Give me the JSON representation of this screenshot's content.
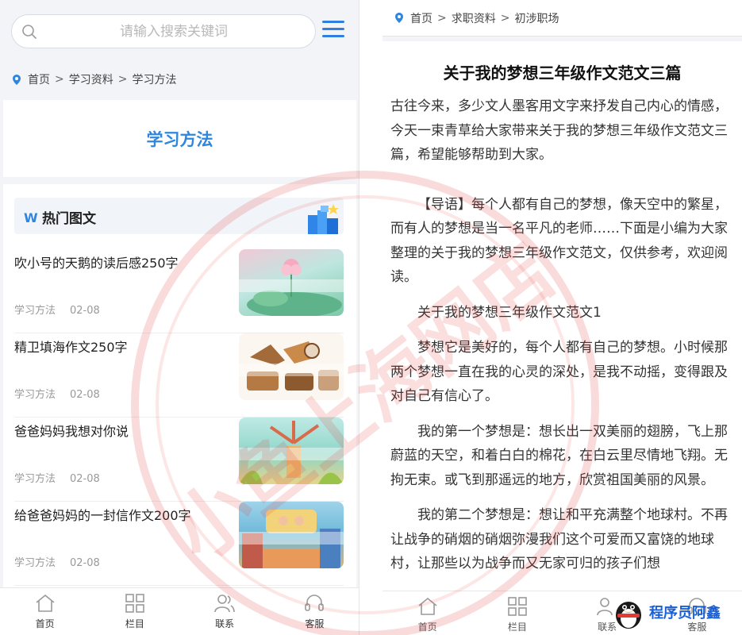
{
  "left": {
    "search": {
      "placeholder": "请输入搜索关键词"
    },
    "breadcrumb": {
      "home": "首页",
      "section": "学习资料",
      "current": "学习方法"
    },
    "page_title": "学习方法",
    "hot": {
      "title": "热门图文",
      "items": [
        {
          "title": "吹小号的天鹅的读后感250字",
          "category": "学习方法",
          "date": "02-08",
          "thumb_caption": "吹小号的天鹅的读后感250字"
        },
        {
          "title": "精卫填海作文250字",
          "category": "学习方法",
          "date": "02-08",
          "thumb_caption": ""
        },
        {
          "title": "爸爸妈妈我想对你说",
          "category": "学习方法",
          "date": "02-08",
          "thumb_caption": "爸爸妈妈我想对你说"
        },
        {
          "title": "给爸爸妈妈的一封信作文200字",
          "category": "学习方法",
          "date": "02-08",
          "thumb_caption": "给爸爸妈妈的一封信作文200字"
        }
      ]
    },
    "tabs": [
      {
        "label": "首页",
        "icon": "home-icon"
      },
      {
        "label": "栏目",
        "icon": "grid-icon"
      },
      {
        "label": "联系",
        "icon": "users-icon"
      },
      {
        "label": "客服",
        "icon": "headset-icon"
      }
    ]
  },
  "right": {
    "breadcrumb": {
      "home": "首页",
      "section": "求职资料",
      "current": "初涉职场"
    },
    "article": {
      "title": "关于我的梦想三年级作文范文三篇",
      "intro": "古往今来，多少文人墨客用文字来抒发自己内心的情感，今天一束青草给大家带来关于我的梦想三年级作文范文三篇，希望能够帮助到大家。",
      "guide": "【导语】每个人都有自己的梦想，像天空中的繁星，而有人的梦想是当一名平凡的老师……下面是小编为大家整理的关于我的梦想三年级作文范文，仅供参考，欢迎阅读。",
      "subtitle": "关于我的梦想三年级作文范文1",
      "p1": "梦想它是美好的，每个人都有自己的梦想。小时候那两个梦想一直在我的心灵的深处，是我不动摇，变得跟及对自己有信心了。",
      "p2": "我的第一个梦想是：想长出一双美丽的翅膀，飞上那蔚蓝的天空，和着白白的棉花，在白云里尽情地飞翔。无拘无束。或飞到那遥远的地方，欣赏祖国美丽的风景。",
      "p3": "我的第二个梦想是：想让和平充满整个地球村。不再让战争的硝烟的硝烟弥漫我们这个可爱而又富饶的地球村，让那些以为战争而又无家可归的孩子们想"
    },
    "tabs": [
      {
        "label": "首页",
        "icon": "home-icon"
      },
      {
        "label": "栏目",
        "icon": "grid-icon"
      },
      {
        "label": "联系",
        "icon": "users-icon"
      },
      {
        "label": "客服",
        "icon": "headset-icon"
      }
    ]
  },
  "watermark": {
    "text": "小鱼上海网店"
  },
  "brand": {
    "text": "程序员阿鑫"
  },
  "colors": {
    "accent": "#2e86de",
    "menu": "#2e7fe0",
    "watermark": "#e53935",
    "brand": "#1a5fd6"
  }
}
